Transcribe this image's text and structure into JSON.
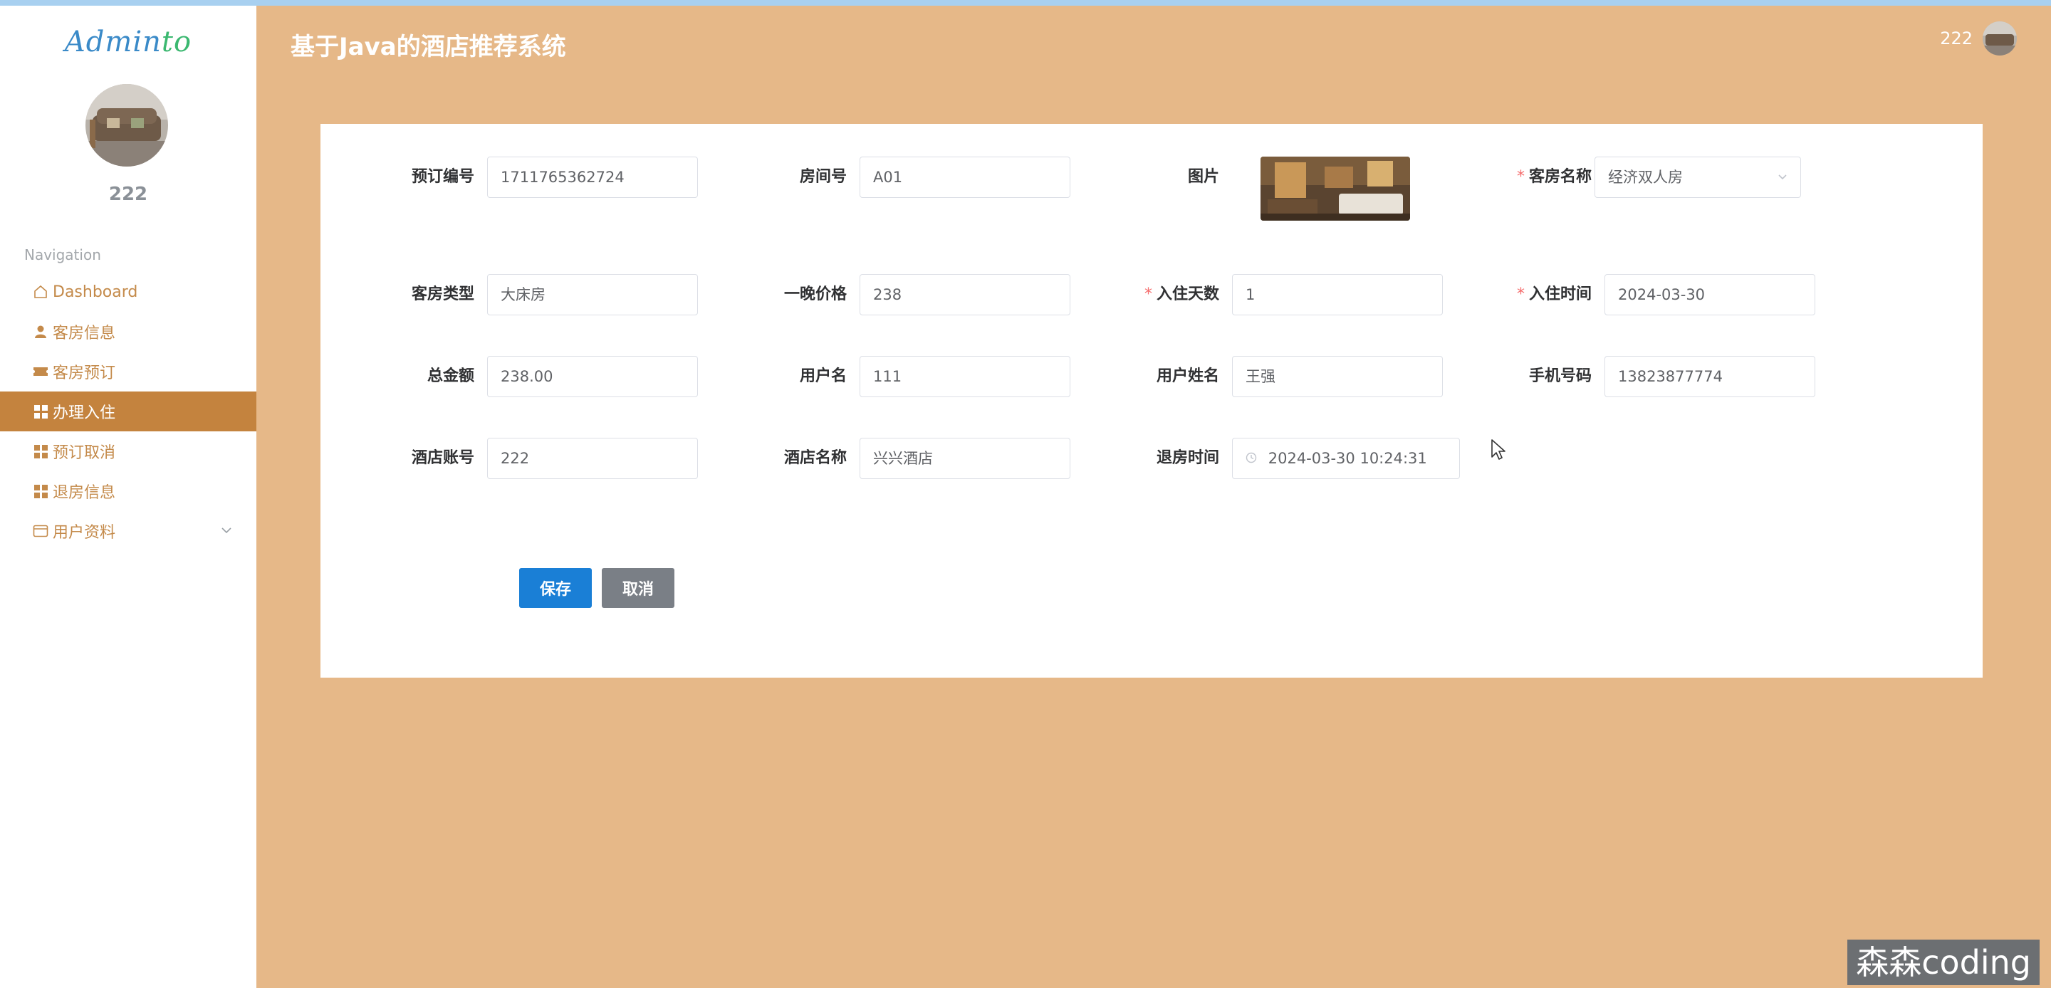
{
  "app": {
    "logo_main": "Admin",
    "logo_accent": "to",
    "title": "基于Java的酒店推荐系统",
    "header_user": "222"
  },
  "sidebar": {
    "username": "222",
    "nav_title": "Navigation",
    "items": [
      {
        "label": "Dashboard",
        "icon": "home-icon"
      },
      {
        "label": "客房信息",
        "icon": "user-icon"
      },
      {
        "label": "客房预订",
        "icon": "ticket-icon"
      },
      {
        "label": "办理入住",
        "icon": "grid-icon",
        "active": true
      },
      {
        "label": "预订取消",
        "icon": "grid-icon"
      },
      {
        "label": "退房信息",
        "icon": "grid-icon"
      },
      {
        "label": "用户资料",
        "icon": "card-icon",
        "has_submenu": true
      }
    ]
  },
  "form": {
    "fields": {
      "booking_no": {
        "label": "预订编号",
        "value": "1711765362724"
      },
      "room_no": {
        "label": "房间号",
        "value": "A01"
      },
      "image": {
        "label": "图片"
      },
      "room_name": {
        "label": "客房名称",
        "value": "经济双人房",
        "required": true
      },
      "room_type": {
        "label": "客房类型",
        "value": "大床房"
      },
      "night_price": {
        "label": "一晚价格",
        "value": "238"
      },
      "stay_days": {
        "label": "入住天数",
        "value": "1",
        "required": true
      },
      "checkin_time": {
        "label": "入住时间",
        "value": "2024-03-30",
        "required": true
      },
      "total_amount": {
        "label": "总金额",
        "value": "238.00"
      },
      "username": {
        "label": "用户名",
        "value": "111"
      },
      "user_realname": {
        "label": "用户姓名",
        "value": "王强"
      },
      "phone": {
        "label": "手机号码",
        "value": "13823877774"
      },
      "hotel_account": {
        "label": "酒店账号",
        "value": "222"
      },
      "hotel_name": {
        "label": "酒店名称",
        "value": "兴兴酒店"
      },
      "checkout_time": {
        "label": "退房时间",
        "value": "2024-03-30 10:24:31"
      }
    },
    "buttons": {
      "save": "保存",
      "cancel": "取消"
    }
  },
  "watermark": "森森coding",
  "colors": {
    "main_bg": "#e6b888",
    "active_nav": "#c4833e",
    "nav_text": "#c48a4a",
    "primary": "#1a7fd6",
    "required": "#f56c6c"
  }
}
